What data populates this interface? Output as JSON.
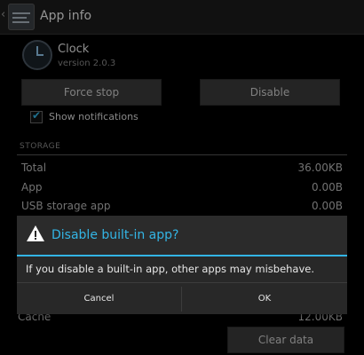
{
  "actionbar": {
    "title": "App info",
    "up_glyph": "‹"
  },
  "app": {
    "name": "Clock",
    "version": "version 2.0.3"
  },
  "buttons": {
    "force_stop": "Force stop",
    "disable": "Disable",
    "clear_data": "Clear data"
  },
  "notifications": {
    "label": "Show notifications",
    "checked": true
  },
  "storage": {
    "header": "STORAGE",
    "rows": [
      {
        "label": "Total",
        "value": "36.00KB"
      },
      {
        "label": "App",
        "value": "0.00B"
      },
      {
        "label": "USB storage app",
        "value": "0.00B"
      }
    ]
  },
  "cache": {
    "label": "Cache",
    "value": "12.00KB"
  },
  "dialog": {
    "title": "Disable built-in app?",
    "message": "If you disable a built-in app, other apps may misbehave.",
    "cancel": "Cancel",
    "ok": "OK",
    "accent": "#33b5e5"
  },
  "icons": [
    "app-settings-icon",
    "clock-icon",
    "checkbox-check-icon",
    "warning-icon"
  ]
}
